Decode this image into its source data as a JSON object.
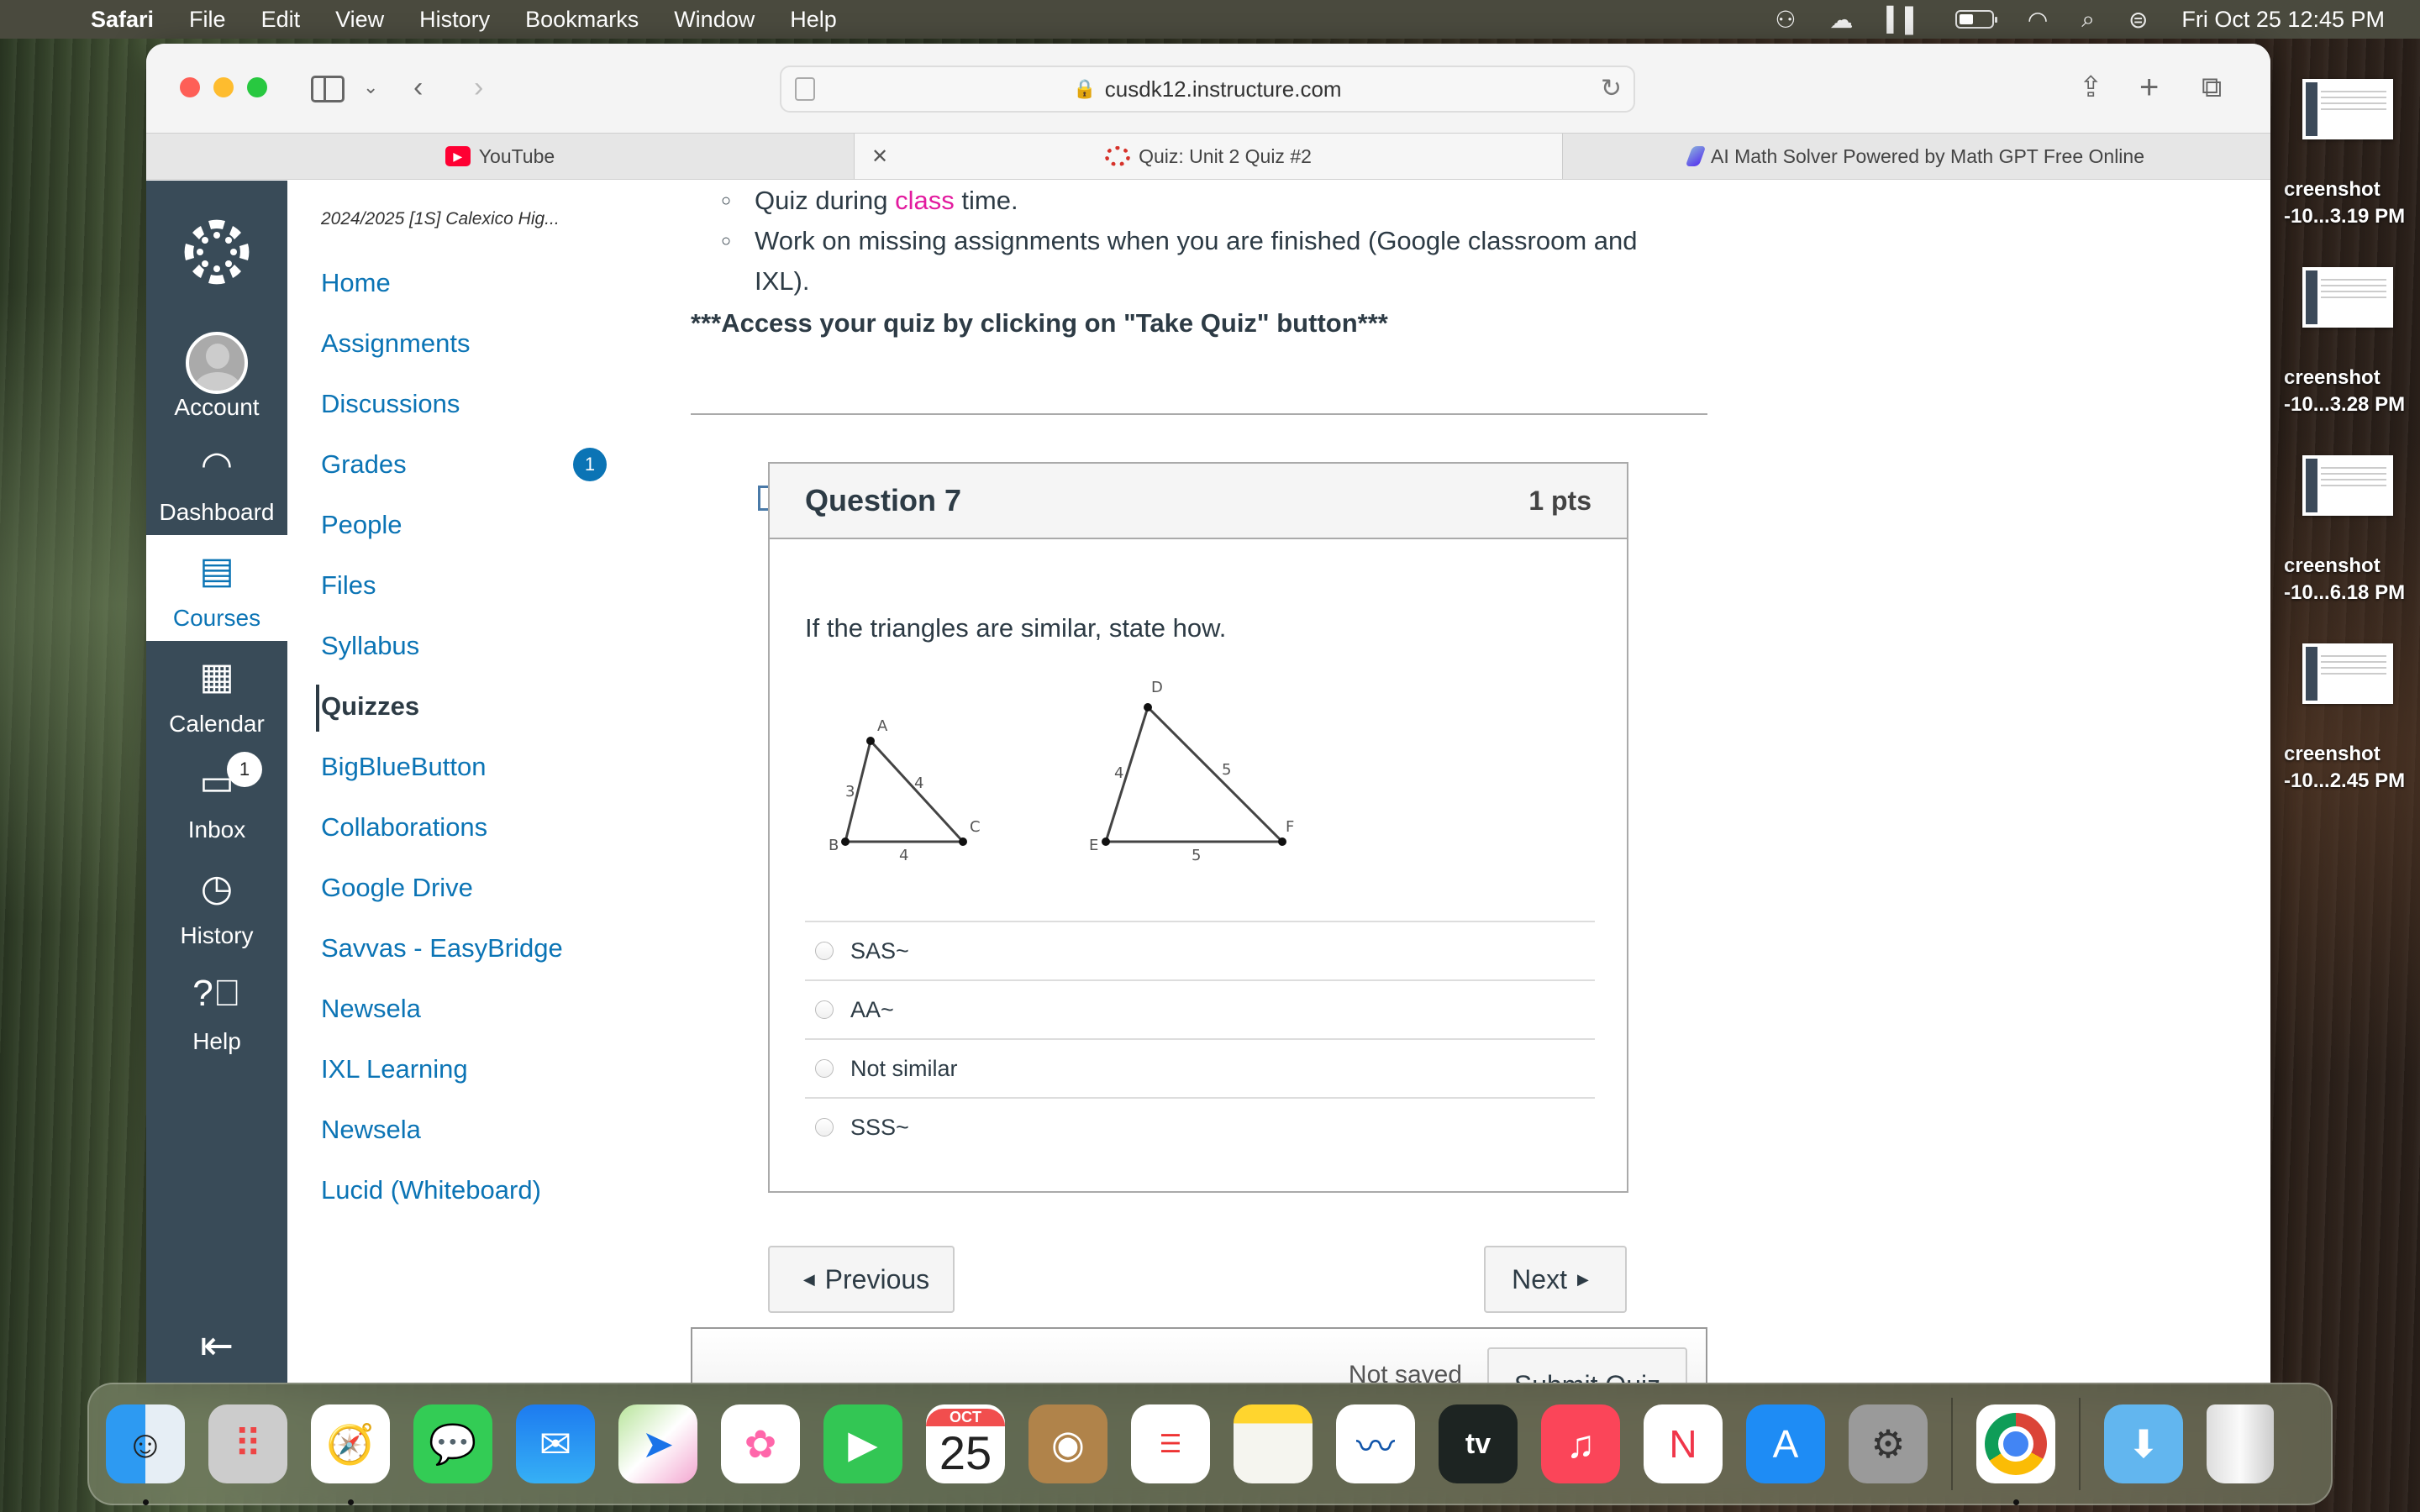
{
  "menubar": {
    "app_name": "Safari",
    "menus": [
      "File",
      "Edit",
      "View",
      "History",
      "Bookmarks",
      "Window",
      "Help"
    ],
    "clock": "Fri Oct 25  12:45 PM",
    "status_icons": [
      "users-icon",
      "weather-icon",
      "audio-icon",
      "battery-icon",
      "wifi-icon",
      "search-icon",
      "control-center-icon"
    ]
  },
  "desktop_files": [
    {
      "line1": "creenshot",
      "line2": "-10...3.19 PM"
    },
    {
      "line1": "creenshot",
      "line2": "-10...3.28 PM"
    },
    {
      "line1": "creenshot",
      "line2": "-10...6.18 PM"
    },
    {
      "line1": "creenshot",
      "line2": "-10...2.45 PM"
    }
  ],
  "browser": {
    "url": "cusdk12.instructure.com",
    "tabs": [
      {
        "label": "YouTube",
        "active": false
      },
      {
        "label": "Quiz: Unit 2 Quiz #2",
        "active": true
      },
      {
        "label": "AI Math Solver Powered by Math GPT Free Online",
        "active": false
      }
    ]
  },
  "global_nav": {
    "items": [
      {
        "label": "Account"
      },
      {
        "label": "Dashboard"
      },
      {
        "label": "Courses",
        "active": true
      },
      {
        "label": "Calendar"
      },
      {
        "label": "Inbox",
        "badge": "1"
      },
      {
        "label": "History"
      },
      {
        "label": "Help"
      }
    ]
  },
  "course_nav": {
    "course_title": "2024/2025 [1S] Calexico Hig...",
    "items": [
      {
        "label": "Home"
      },
      {
        "label": "Assignments"
      },
      {
        "label": "Discussions"
      },
      {
        "label": "Grades",
        "badge": "1"
      },
      {
        "label": "People"
      },
      {
        "label": "Files"
      },
      {
        "label": "Syllabus"
      },
      {
        "label": "Quizzes",
        "active": true
      },
      {
        "label": "BigBlueButton"
      },
      {
        "label": "Collaborations"
      },
      {
        "label": "Google Drive"
      },
      {
        "label": "Savvas - EasyBridge"
      },
      {
        "label": "Newsela"
      },
      {
        "label": "IXL Learning"
      },
      {
        "label": "Newsela"
      },
      {
        "label": "Lucid (Whiteboard)"
      }
    ]
  },
  "instructions": {
    "bullet1_pre": "Quiz during ",
    "bullet1_highlight": "class",
    "bullet1_post": " time.",
    "bullet2": "Work on missing assignments when you are finished (Google classroom and IXL).",
    "access_note": "***Access your quiz by clicking on \"Take Quiz\" button***"
  },
  "question": {
    "title": "Question 7",
    "points": "1 pts",
    "text": "If the triangles are similar, state how.",
    "figure": {
      "triangle1": {
        "vertices": [
          "A",
          "B",
          "C"
        ],
        "sides": {
          "AB": "3",
          "AC": "4",
          "BC": "4"
        }
      },
      "triangle2": {
        "vertices": [
          "D",
          "E",
          "F"
        ],
        "sides": {
          "DE": "4",
          "DF": "5",
          "EF": "5"
        }
      }
    },
    "answers": [
      "SAS~",
      "AA~",
      "Not similar",
      "SSS~"
    ],
    "selected": null
  },
  "navigation": {
    "previous_label": "Previous",
    "next_label": "Next"
  },
  "submit": {
    "status": "Not saved",
    "button_label": "Submit Quiz"
  },
  "dock": {
    "calendar_month": "OCT",
    "calendar_day": "25",
    "apps": [
      "Finder",
      "Launchpad",
      "Safari",
      "Messages",
      "Mail",
      "Maps",
      "Photos",
      "FaceTime",
      "Calendar",
      "Contacts",
      "Reminders",
      "Notes",
      "Freeform",
      "TV",
      "Music",
      "News",
      "App Store",
      "System Settings",
      "Google Chrome",
      "Downloads",
      "Trash"
    ]
  }
}
